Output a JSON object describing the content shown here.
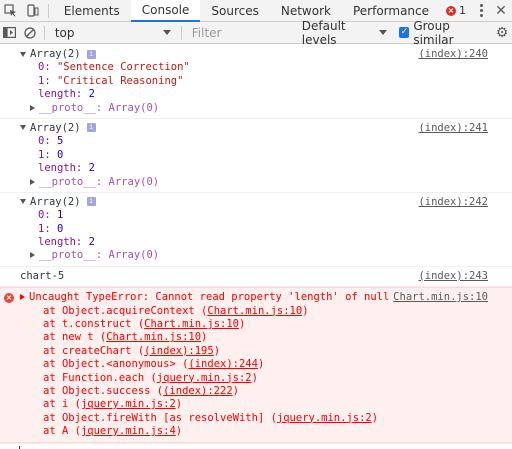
{
  "tabs": [
    "Elements",
    "Console",
    "Sources",
    "Network",
    "Performance"
  ],
  "error_count": "1",
  "toolbar": {
    "context": "top",
    "filter_placeholder": "Filter",
    "levels": "Default levels",
    "group_similar": "Group similar"
  },
  "messages": [
    {
      "head": "Array(2)",
      "source": "(index):240",
      "entries": [
        {
          "key": "0:",
          "val": "\"Sentence Correction\"",
          "kind": "str"
        },
        {
          "key": "1:",
          "val": "\"Critical Reasoning\"",
          "kind": "str"
        },
        {
          "key": "length:",
          "val": "2",
          "kind": "num"
        }
      ],
      "proto": "__proto__: Array(0)"
    },
    {
      "head": "Array(2)",
      "source": "(index):241",
      "entries": [
        {
          "key": "0:",
          "val": "5",
          "kind": "num"
        },
        {
          "key": "1:",
          "val": "0",
          "kind": "num"
        },
        {
          "key": "length:",
          "val": "2",
          "kind": "num"
        }
      ],
      "proto": "__proto__: Array(0)"
    },
    {
      "head": "Array(2)",
      "source": "(index):242",
      "entries": [
        {
          "key": "0:",
          "val": "1",
          "kind": "num"
        },
        {
          "key": "1:",
          "val": "0",
          "kind": "num"
        },
        {
          "key": "length:",
          "val": "2",
          "kind": "num"
        }
      ],
      "proto": "__proto__: Array(0)"
    }
  ],
  "plain_log": {
    "text": "chart-5",
    "source": "(index):243"
  },
  "error": {
    "message": "Uncaught TypeError: Cannot read property 'length' of null",
    "source": "Chart.min.js:10",
    "stack": [
      {
        "pre": "at Object.acquireContext (",
        "link": "Chart.min.js:10",
        "post": ")"
      },
      {
        "pre": "at t.construct (",
        "link": "Chart.min.js:10",
        "post": ")"
      },
      {
        "pre": "at new t (",
        "link": "Chart.min.js:10",
        "post": ")"
      },
      {
        "pre": "at createChart (",
        "link": "(index):195",
        "post": ")"
      },
      {
        "pre": "at Object.<anonymous> (",
        "link": "(index):244",
        "post": ")"
      },
      {
        "pre": "at Function.each (",
        "link": "jquery.min.js:2",
        "post": ")"
      },
      {
        "pre": "at Object.success (",
        "link": "(index):222",
        "post": ")"
      },
      {
        "pre": "at i (",
        "link": "jquery.min.js:2",
        "post": ")"
      },
      {
        "pre": "at Object.fireWith [as resolveWith] (",
        "link": "jquery.min.js:2",
        "post": ")"
      },
      {
        "pre": "at A (",
        "link": "jquery.min.js:4",
        "post": ")"
      }
    ]
  },
  "prompt_symbol": "›",
  "icons": {
    "inspect": "inspect-icon",
    "device": "device-toolbar-icon",
    "sidebar": "console-sidebar-icon",
    "clear": "clear-console-icon",
    "settings": "gear-icon",
    "close": "close-icon"
  }
}
